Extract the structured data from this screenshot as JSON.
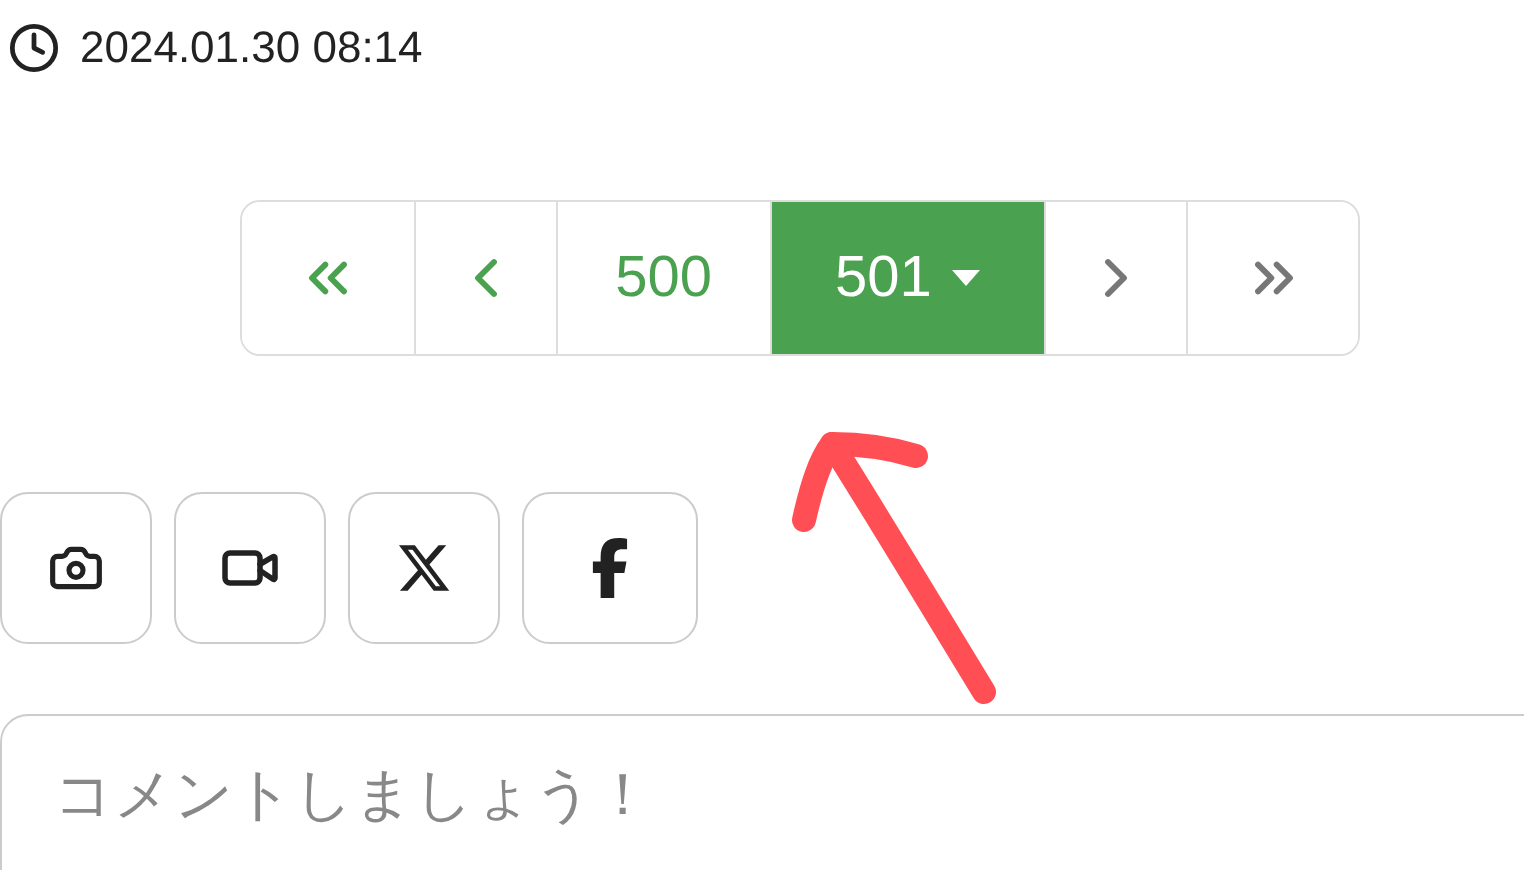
{
  "timestamp": "2024.01.30 08:14",
  "pagination": [
    {
      "kind": "first",
      "disabled": false
    },
    {
      "kind": "prev",
      "disabled": false
    },
    {
      "kind": "page",
      "label": "500",
      "selected": false
    },
    {
      "kind": "page",
      "label": "501",
      "selected": true
    },
    {
      "kind": "next",
      "disabled": true
    },
    {
      "kind": "last",
      "disabled": true
    }
  ],
  "share_buttons": [
    {
      "kind": "camera"
    },
    {
      "kind": "video"
    },
    {
      "kind": "x"
    },
    {
      "kind": "facebook"
    }
  ],
  "comment": {
    "placeholder": "コメントしましょう！"
  }
}
